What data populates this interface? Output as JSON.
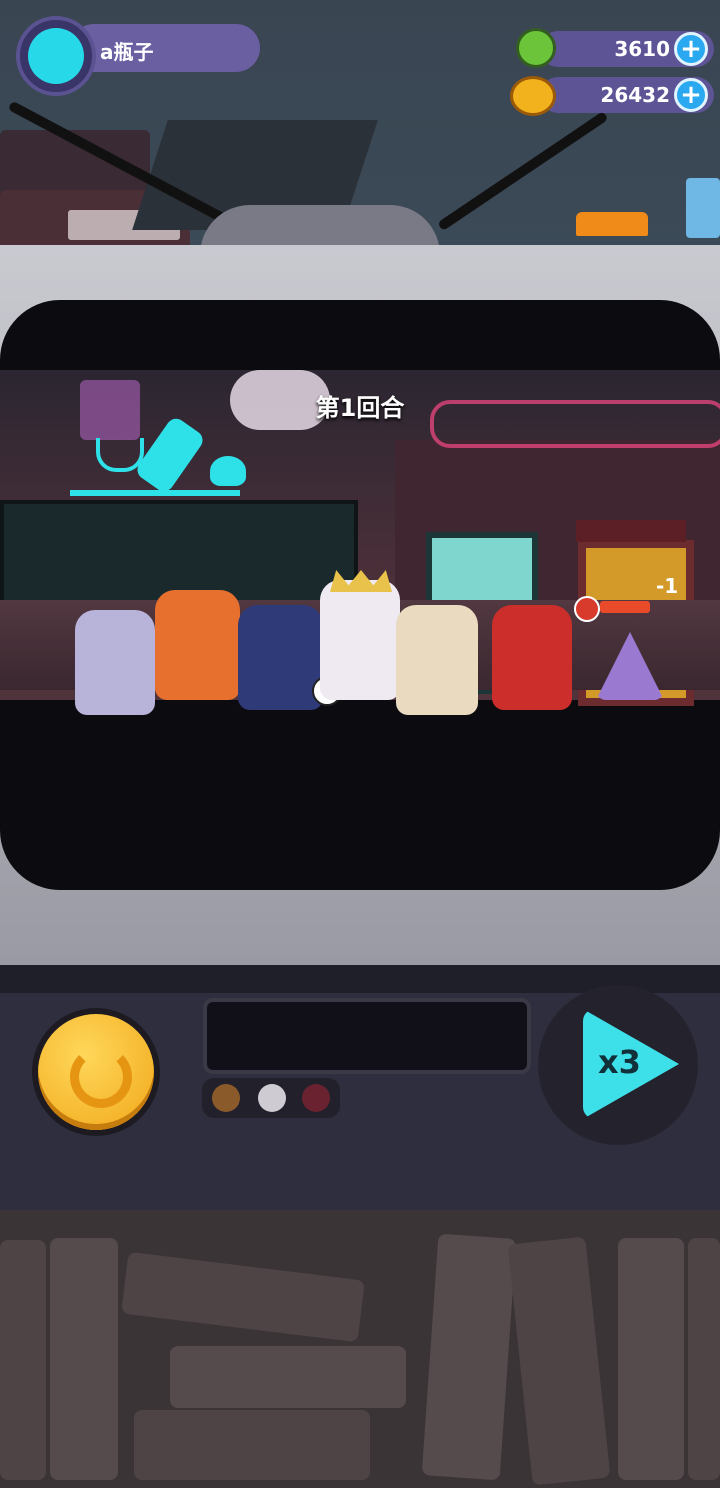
{
  "player": {
    "name": "a瓶子"
  },
  "resources": [
    {
      "icon": "green-gem-icon",
      "value": "3610"
    },
    {
      "icon": "gold-coin-icon",
      "value": "26432"
    }
  ],
  "battle": {
    "round_label": "第1回合",
    "enemy_hp_delta": "-1"
  },
  "controls": {
    "speed_label": "x3"
  }
}
